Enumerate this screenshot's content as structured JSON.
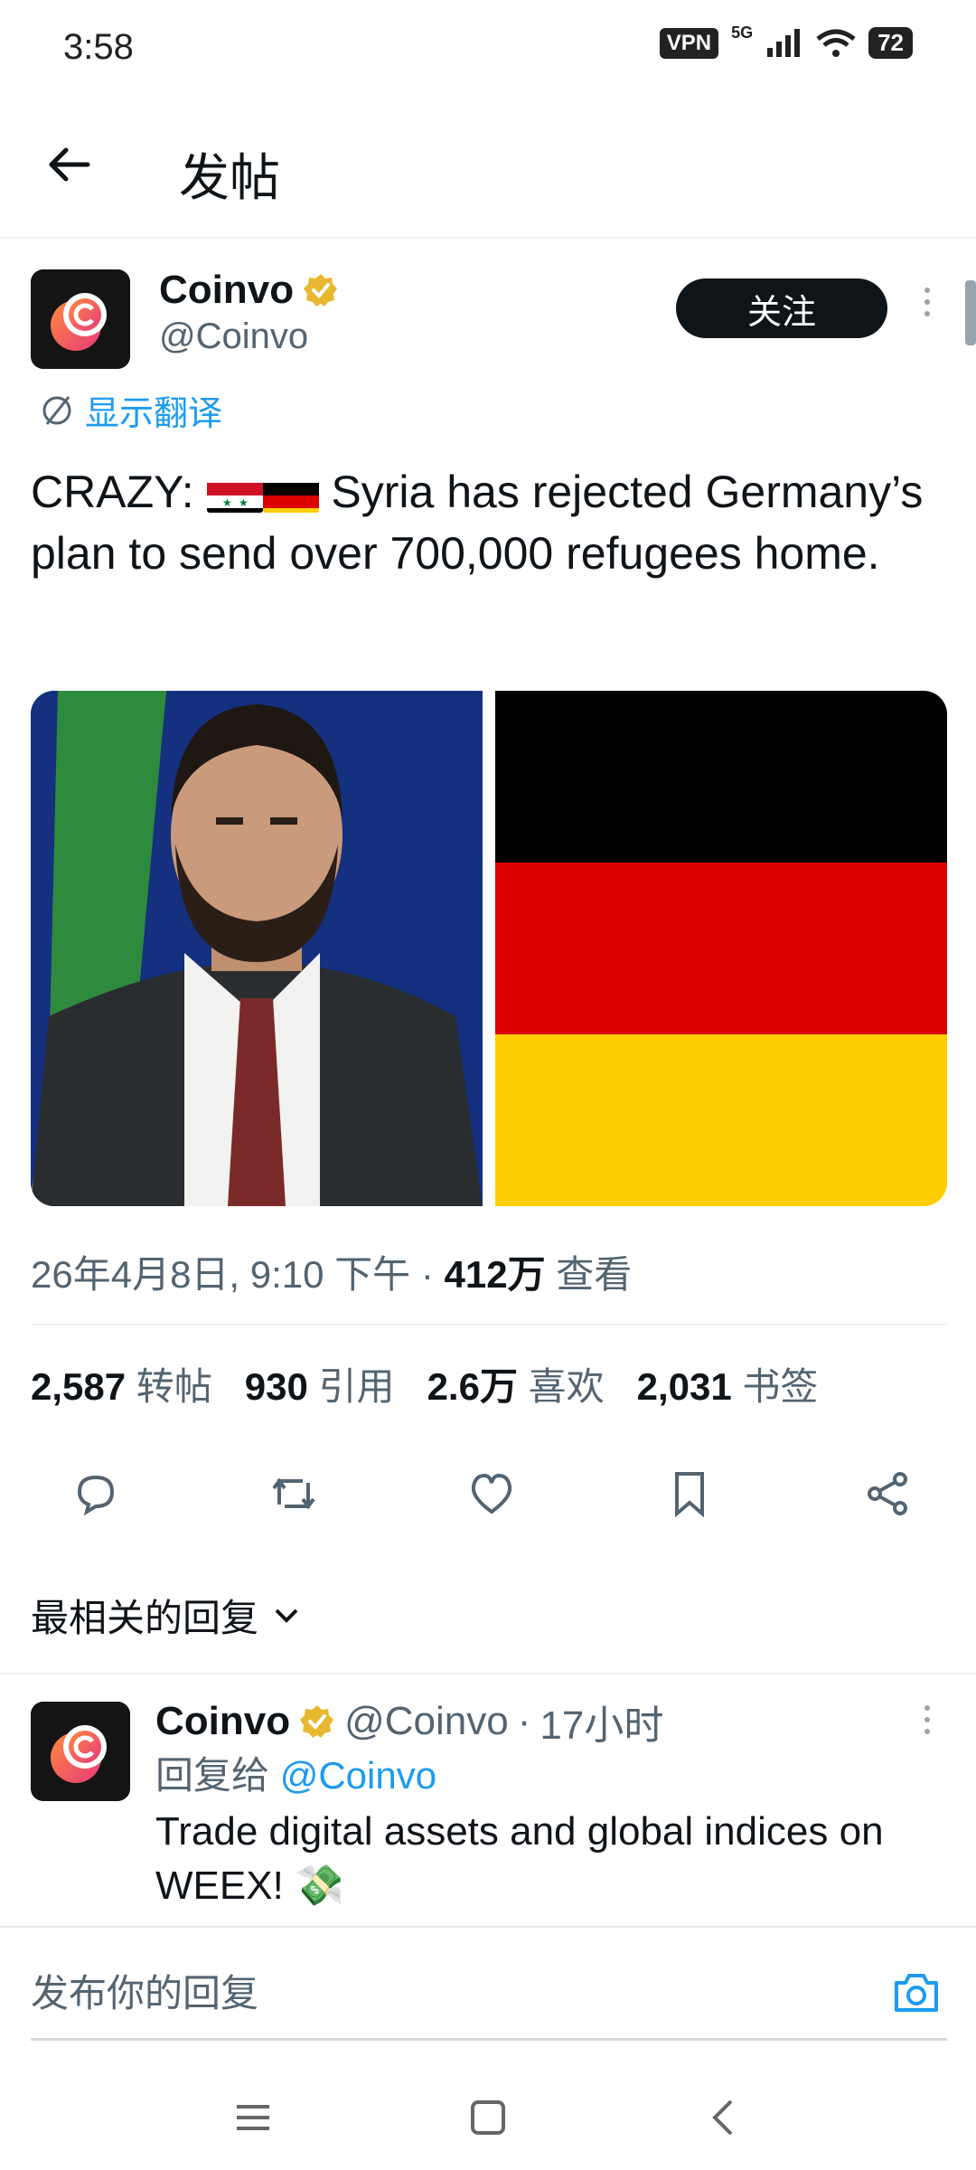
{
  "status_bar": {
    "time": "3:58",
    "vpn": "VPN",
    "network": "5G",
    "battery": "72"
  },
  "header": {
    "title": "发帖"
  },
  "post": {
    "author_name": "Coinvo",
    "author_handle": "@Coinvo",
    "follow_label": "关注",
    "translate_label": "显示翻译",
    "text_prefix": "CRAZY:",
    "text_body": "Syria has rejected Germany’s plan to send over 700,000 refugees home.",
    "meta": {
      "datetime": "26年4月8日, 9:10 下午",
      "views_count": "412万",
      "views_label": "查看"
    },
    "stats": [
      {
        "count": "2,587",
        "label": "转帖"
      },
      {
        "count": "930",
        "label": "引用"
      },
      {
        "count": "2.6万",
        "label": "喜欢"
      },
      {
        "count": "2,031",
        "label": "书签"
      }
    ]
  },
  "replies": {
    "header": "最相关的回复",
    "items": [
      {
        "author_name": "Coinvo",
        "author_handle": "@Coinvo",
        "time": "17小时",
        "reply_to_label": "回复给",
        "reply_to_handle": "@Coinvo",
        "text": "Trade digital assets and global indices on WEEX! 💸"
      }
    ]
  },
  "reply_bar": {
    "placeholder": "发布你的回复"
  },
  "icons": {
    "back": "arrow-left-icon",
    "verified": "verified-badge-icon",
    "translate": "translate-icon",
    "reply": "comment-icon",
    "retweet": "retweet-icon",
    "like": "heart-icon",
    "bookmark": "bookmark-icon",
    "share": "share-icon",
    "camera": "camera-icon"
  },
  "colors": {
    "accent": "#1d9bf0",
    "text": "#0f1419",
    "muted": "#536471",
    "verified": "#e8b830"
  }
}
